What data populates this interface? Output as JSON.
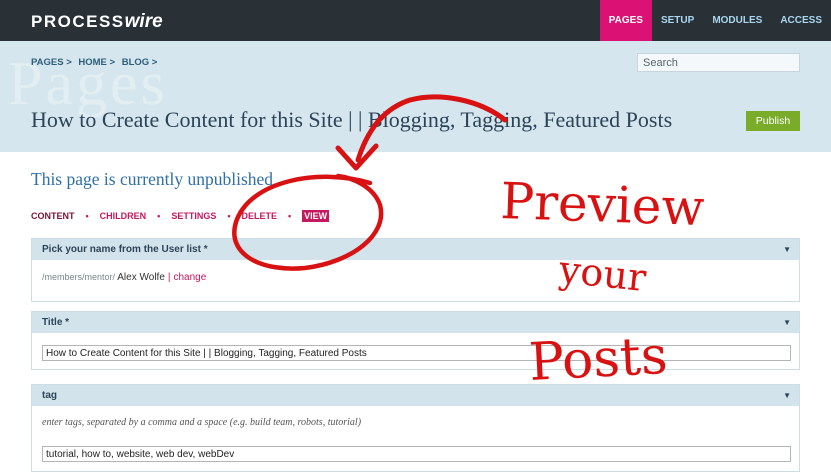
{
  "app": {
    "logo_brand": "PROCESS",
    "logo_suffix": "wire"
  },
  "nav": {
    "items": [
      {
        "label": "PAGES",
        "active": true
      },
      {
        "label": "SETUP",
        "active": false
      },
      {
        "label": "MODULES",
        "active": false
      },
      {
        "label": "ACCESS",
        "active": false
      }
    ]
  },
  "header": {
    "watermark": "Pages",
    "breadcrumbs": [
      "PAGES >",
      "HOME >",
      "BLOG >"
    ],
    "search_placeholder": "Search",
    "page_title": "How to Create Content for this Site | | Blogging, Tagging, Featured Posts",
    "publish_label": "Publish"
  },
  "main": {
    "status_heading": "This page is currently unpublished",
    "tabs": [
      {
        "label": "CONTENT"
      },
      {
        "label": "CHILDREN"
      },
      {
        "label": "SETTINGS"
      },
      {
        "label": "DELETE"
      },
      {
        "label": "VIEW"
      }
    ],
    "separator": "•",
    "fields": {
      "user": {
        "label": "Pick your name from the User list *",
        "path": "/members/mentor/",
        "name": "Alex Wolfe",
        "separator": "|",
        "change_label": "change"
      },
      "title": {
        "label": "Title *",
        "value": "How to Create Content for this Site | |  Blogging, Tagging, Featured Posts"
      },
      "tag": {
        "label": "tag",
        "hint": "enter tags, separated by a comma and a space (e.g. build team, robots, tutorial)",
        "value": "tutorial, how to, website, web dev, webDev"
      }
    },
    "caret_icon": "▼"
  },
  "annotation": {
    "line1": "Preview",
    "line2": "your",
    "line3": "Posts",
    "color": "#d81212"
  }
}
